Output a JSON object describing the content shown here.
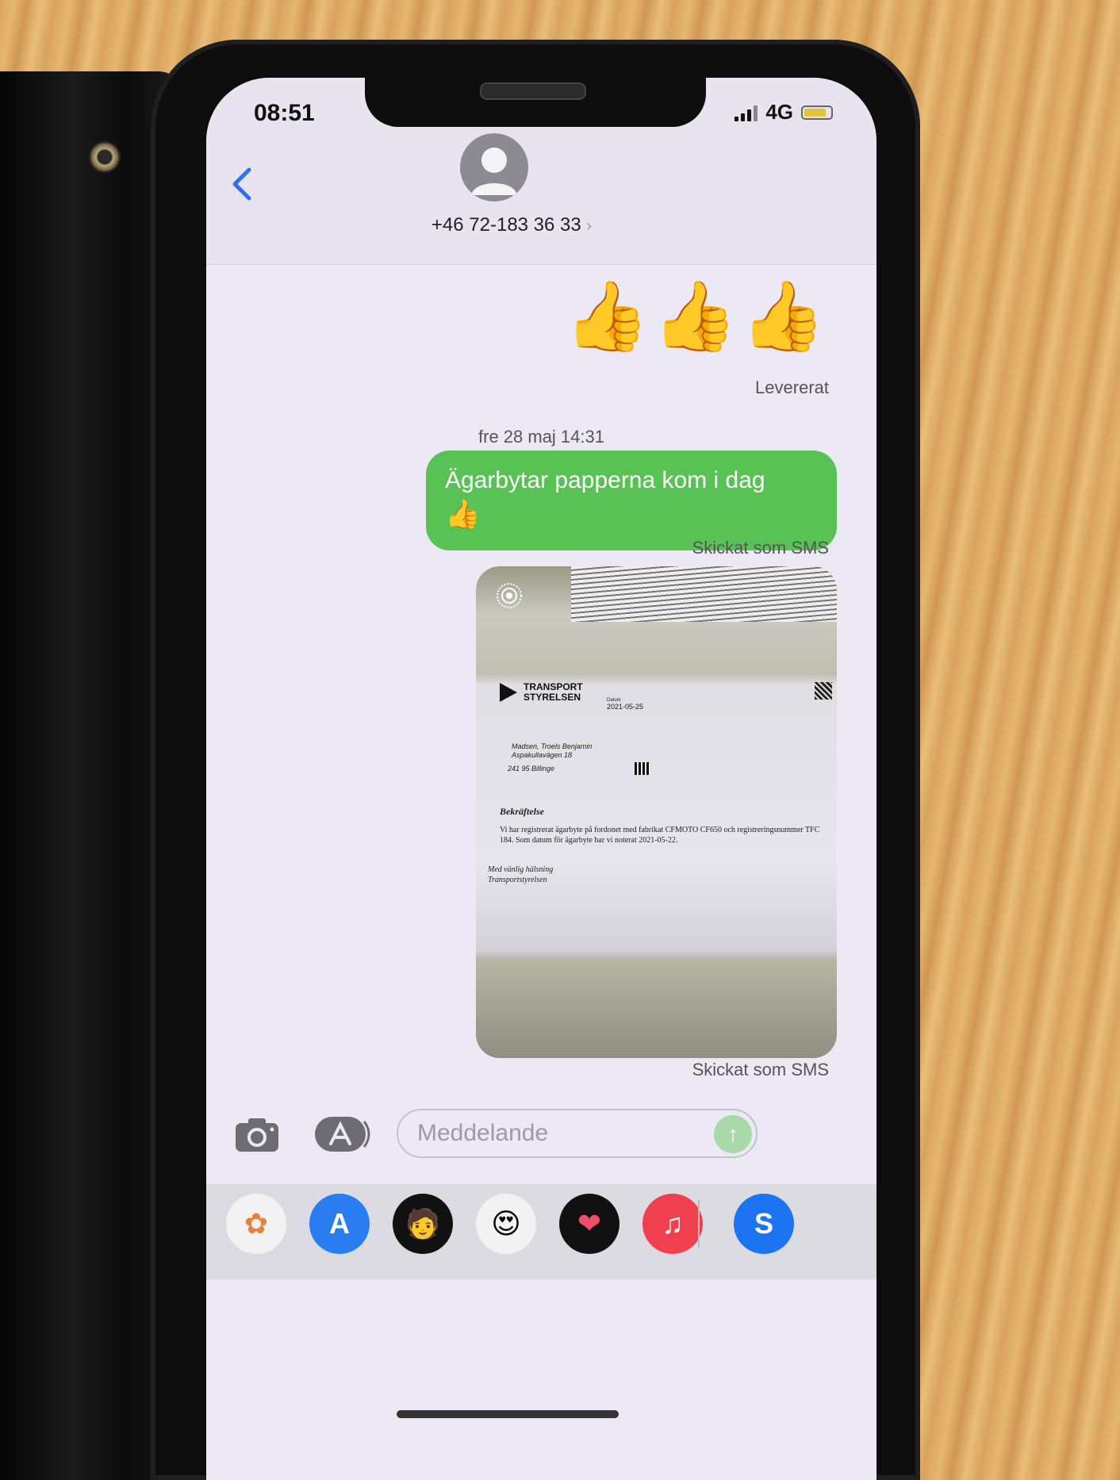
{
  "status_bar": {
    "time": "08:51",
    "network": "4G"
  },
  "header": {
    "contact": "+46 72-183 36 33",
    "chevron": "›"
  },
  "messages": {
    "emoji_message": "👍👍👍",
    "emoji_status": "Levererat",
    "timestamp": "fre 28 maj 14:31",
    "text_message": "Ägarbytar papperna kom i dag",
    "text_emoji": "👍",
    "text_status": "Skickat som SMS",
    "photo_status": "Skickat som SMS"
  },
  "photo_document": {
    "logo_line1": "TRANSPORT",
    "logo_line2": "STYRELSEN",
    "date_label": "Datum",
    "date": "2021-05-25",
    "addr_line1": "Madsen, Troels Benjamin",
    "addr_line2": "Aspakullavägen 18",
    "city": "241 95 Billinge",
    "heading": "Bekräftelse",
    "body": "Vi har registrerat ägarbyte på fordonet med fabrikat CFMOTO CF650 och registreringsnummer TFC 184. Som datum för ägarbyte har vi noterat 2021-05-22.",
    "sign_line1": "Med vänlig hälsning",
    "sign_line2": "Transportstyrelsen"
  },
  "composer": {
    "placeholder": "Meddelande",
    "send_glyph": "↑"
  },
  "dock_apps": [
    {
      "name": "photos",
      "glyph": "✿",
      "bg": "#f2f2f2"
    },
    {
      "name": "app-store",
      "glyph": "A",
      "bg": "#2a7df0"
    },
    {
      "name": "memoji-camera",
      "glyph": "🧑",
      "bg": "#111111"
    },
    {
      "name": "memoji-stickers",
      "glyph": "😍",
      "bg": "#f2f2f2"
    },
    {
      "name": "digital-touch",
      "glyph": "❤",
      "bg": "#111111"
    },
    {
      "name": "music",
      "glyph": "♫",
      "bg": "#f0404f"
    },
    {
      "name": "shazam",
      "glyph": "S",
      "bg": "#1d74f2"
    }
  ],
  "colors": {
    "imessage_blue": "#2f6ff0",
    "sms_green": "#58c254"
  }
}
